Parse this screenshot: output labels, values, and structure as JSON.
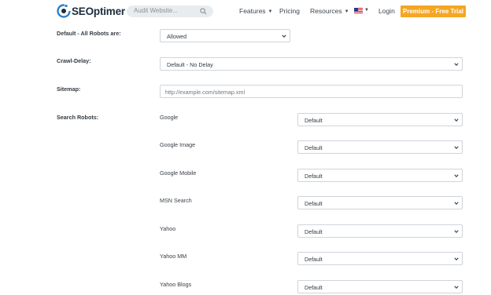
{
  "header": {
    "logo_text": "SEOptimer",
    "search_placeholder": "Audit Website...",
    "nav": {
      "features": "Features",
      "pricing": "Pricing",
      "resources": "Resources",
      "login": "Login",
      "premium": "Premium - Free Trial"
    },
    "language_flag": "us-flag-icon"
  },
  "form": {
    "default_robots": {
      "label": "Default - All Robots are:",
      "value": "Allowed"
    },
    "crawl_delay": {
      "label": "Crawl-Delay:",
      "value": "Default - No Delay"
    },
    "sitemap": {
      "label": "Sitemap:",
      "placeholder": "http://example.com/sitemap.xml",
      "value": ""
    },
    "search_robots": {
      "label": "Search Robots:",
      "robots": [
        {
          "name": "Google",
          "value": "Default"
        },
        {
          "name": "Google Image",
          "value": "Default"
        },
        {
          "name": "Google Mobile",
          "value": "Default"
        },
        {
          "name": "MSN Search",
          "value": "Default"
        },
        {
          "name": "Yahoo",
          "value": "Default"
        },
        {
          "name": "Yahoo MM",
          "value": "Default"
        },
        {
          "name": "Yahoo Blogs",
          "value": "Default"
        }
      ]
    }
  },
  "colors": {
    "accent": "#f5a623",
    "logo_dark": "#1d2d3d",
    "logo_blue": "#2f80c9"
  }
}
